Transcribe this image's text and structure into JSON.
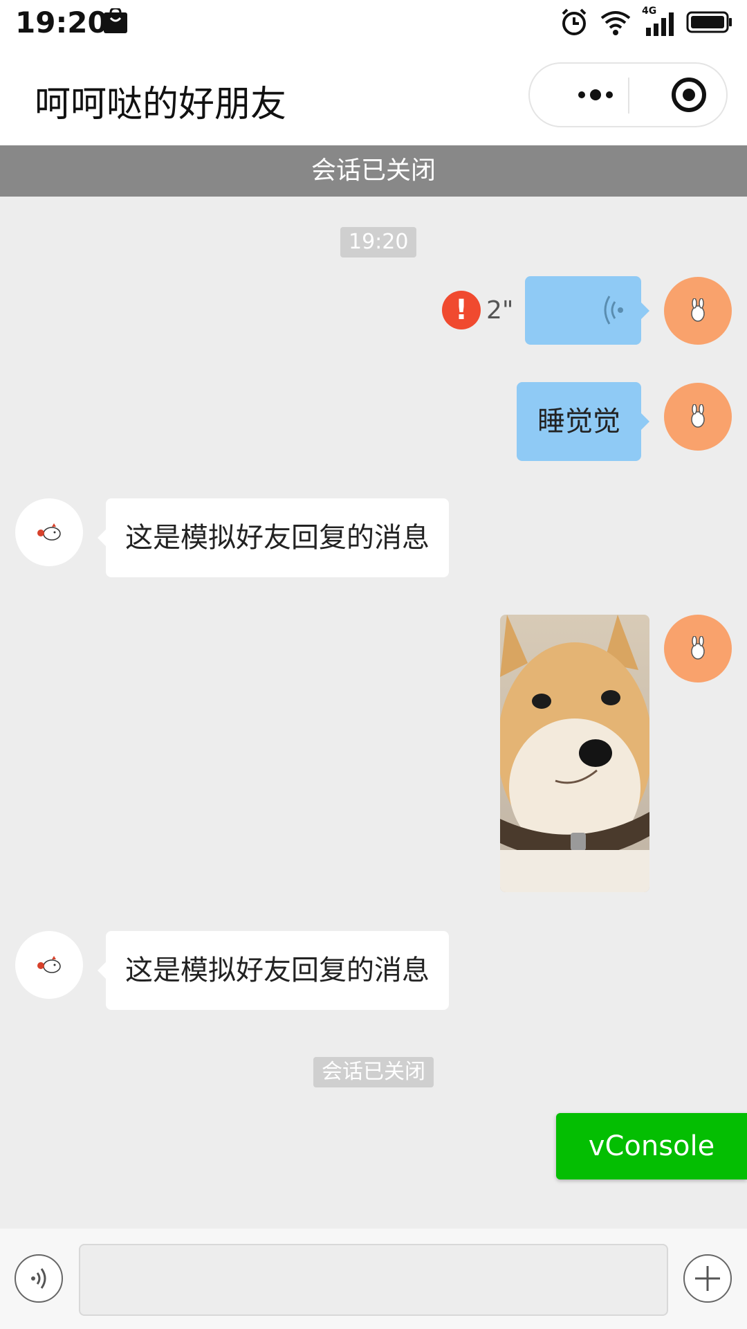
{
  "status_bar": {
    "time": "19:20",
    "network": "4G"
  },
  "navbar": {
    "title": "呵呵哒的好朋友"
  },
  "banner": {
    "text": "会话已关闭"
  },
  "messages": {
    "timestamp": "19:20",
    "voice_duration": "2\"",
    "voice_error_mark": "!",
    "text_sent": "睡觉觉",
    "friend_reply_1": "这是模拟好友回复的消息",
    "friend_reply_2": "这是模拟好友回复的消息",
    "closed_notice": "会话已关闭"
  },
  "vconsole": {
    "label": "vConsole"
  },
  "bottom_bar": {
    "input_value": ""
  },
  "colors": {
    "my_bubble": "#8fcaf5",
    "my_avatar": "#f9a26c",
    "banner_bg": "#888888",
    "vconsole_green": "#04be02",
    "error_red": "#f04a2f"
  }
}
